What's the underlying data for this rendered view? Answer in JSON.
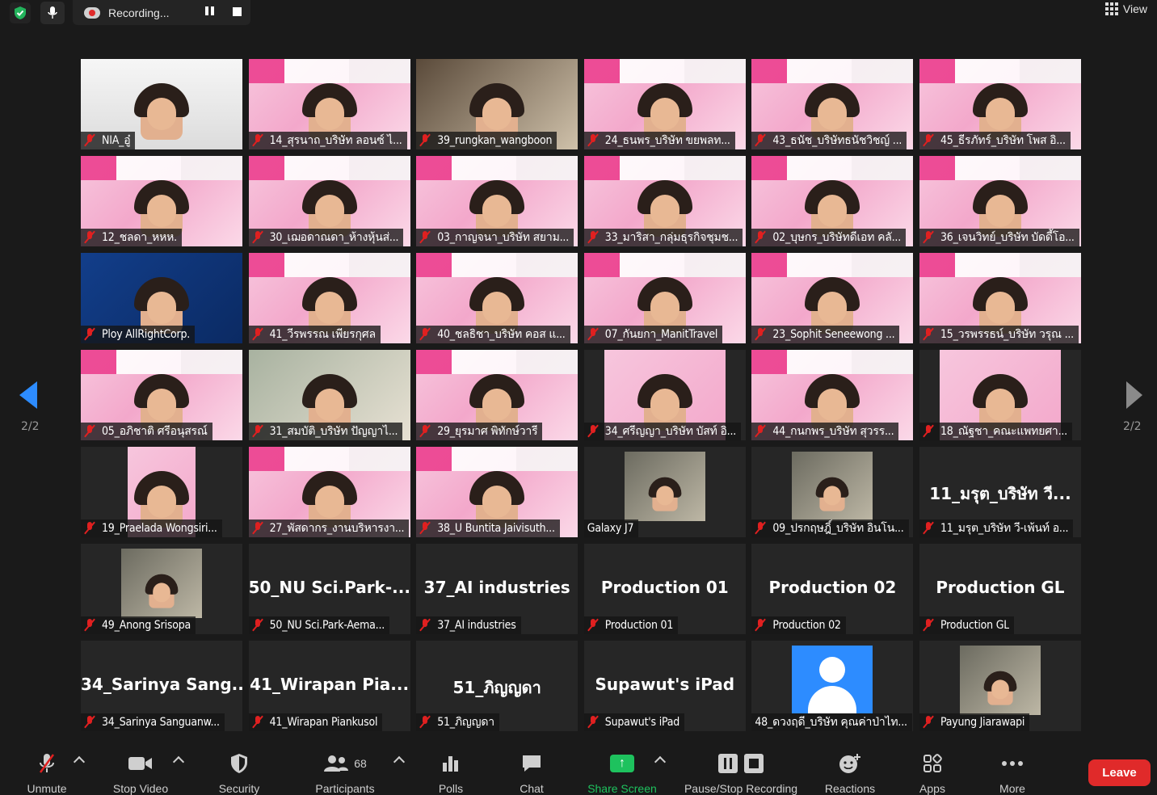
{
  "top": {
    "recording_label": "Recording...",
    "view_label": "View"
  },
  "pager": {
    "left": "2/2",
    "right": "2/2"
  },
  "tiles": [
    {
      "label": "NIA_อู๋",
      "style": "white",
      "big": ""
    },
    {
      "label": "14_สุรนาถ_บริษัท ลอนซ์ ไ...",
      "style": "pink",
      "big": ""
    },
    {
      "label": "39_rungkan_wangboon",
      "style": "office",
      "big": ""
    },
    {
      "label": "24_ธนพร_บริษัท ขยพลท...",
      "style": "pink",
      "big": ""
    },
    {
      "label": "43_ธนัช_บริษัทธนัชวิชญ์ ...",
      "style": "pink",
      "big": ""
    },
    {
      "label": "45_ธีรภัทร์_บริษัท โพส อิ...",
      "style": "pink",
      "big": ""
    },
    {
      "label": "12_ชลดา_หหห.",
      "style": "pink",
      "big": ""
    },
    {
      "label": "30_เฌอดาณดา_ห้างหุ้นส่...",
      "style": "pink",
      "big": ""
    },
    {
      "label": "03_กาญจนา_บริษัท สยาม...",
      "style": "pink",
      "big": ""
    },
    {
      "label": "33_มาริสา_กลุ่มธุรกิจชุมช...",
      "style": "pink",
      "big": ""
    },
    {
      "label": "02_บุษกร_บริษัทดีเอท คลั...",
      "style": "pink",
      "big": ""
    },
    {
      "label": "36_เจนวิทย์_บริษัท บัดดี้โอ...",
      "style": "pink",
      "big": ""
    },
    {
      "label": "Ploy AllRightCorp.",
      "style": "blue",
      "big": ""
    },
    {
      "label": "41_วีรพรรณ เพียรกุศล",
      "style": "pink",
      "big": ""
    },
    {
      "label": "40_ชลธิชา_บริษัท คอส แ...",
      "style": "pink",
      "big": ""
    },
    {
      "label": "07_กันยกา_ManitTravel",
      "style": "pink",
      "big": ""
    },
    {
      "label": "23_Sophit Seneewong ...",
      "style": "pink",
      "big": ""
    },
    {
      "label": "15_วรพรรธน์_บริษัท วรุณ ...",
      "style": "pink",
      "big": ""
    },
    {
      "label": "05_อภิชาติ ศรีอนุสรณ์",
      "style": "pink",
      "big": ""
    },
    {
      "label": "31_สมบัติ_บริษัท ปัญญาไ...",
      "style": "room",
      "big": ""
    },
    {
      "label": "29_ยุรมาศ พิทักษ์วารี",
      "style": "pink",
      "big": ""
    },
    {
      "label": "34_ศรีญญา_บริษัท บัสท์ อิ...",
      "style": "inset-pink",
      "big": ""
    },
    {
      "label": "44_กนกพร_บริษัท สุวรร...",
      "style": "pink",
      "big": ""
    },
    {
      "label": "18_ณัฐชา_คณะแพทยศา...",
      "style": "inset-pink",
      "big": ""
    },
    {
      "label": "19_Praelada Wongsiri...",
      "style": "inset-narrow",
      "big": ""
    },
    {
      "label": "27_พัสดากร_งานบริหารงา...",
      "style": "pink",
      "big": ""
    },
    {
      "label": "38_U Buntita Jaivisuth...",
      "style": "pink",
      "big": ""
    },
    {
      "label": "Galaxy J7",
      "style": "inset-photo",
      "big": ""
    },
    {
      "label": "09_ปรกฤษฎิ์_บริษัท อินโน...",
      "style": "inset-photo",
      "big": ""
    },
    {
      "label": "11_มรุต_บริษัท วี-เพ้นท์ อ...",
      "style": "dark",
      "big": "11_มรุต_บริษัท วี..."
    },
    {
      "label": "49_Anong Srisopa",
      "style": "inset-photo",
      "big": ""
    },
    {
      "label": "50_NU Sci.Park-Aema...",
      "style": "dark",
      "big": "50_NU Sci.Park-..."
    },
    {
      "label": "37_AI industries",
      "style": "dark",
      "big": "37_AI industries"
    },
    {
      "label": "Production 01",
      "style": "dark",
      "big": "Production 01"
    },
    {
      "label": "Production 02",
      "style": "dark",
      "big": "Production 02"
    },
    {
      "label": "Production GL",
      "style": "dark",
      "big": "Production GL"
    },
    {
      "label": "34_Sarinya Sanguanw...",
      "style": "dark",
      "big": "34_Sarinya Sang..."
    },
    {
      "label": "41_Wirapan Piankusol",
      "style": "dark",
      "big": "41_Wirapan Pia..."
    },
    {
      "label": "51_ภิญญดา",
      "style": "dark",
      "big": "51_ภิญญดา"
    },
    {
      "label": "Supawut's iPad",
      "style": "dark",
      "big": "Supawut's iPad"
    },
    {
      "label": "48_ดวงฤดี_บริษัท คุณค่าป่าไท...",
      "style": "avatar",
      "big": ""
    },
    {
      "label": "Payung Jiarawapi",
      "style": "inset-photo",
      "big": ""
    }
  ],
  "toolbar": {
    "unmute": "Unmute",
    "stop_video": "Stop Video",
    "security": "Security",
    "participants": "Participants",
    "participants_count": "68",
    "polls": "Polls",
    "chat": "Chat",
    "share_screen": "Share Screen",
    "pause_stop_recording": "Pause/Stop Recording",
    "reactions": "Reactions",
    "apps": "Apps",
    "more": "More",
    "leave": "Leave"
  },
  "colors": {
    "accent": "#2d8cff",
    "leave": "#e02a2a",
    "share": "#1ec25e",
    "muted_icon": "#e02020"
  }
}
